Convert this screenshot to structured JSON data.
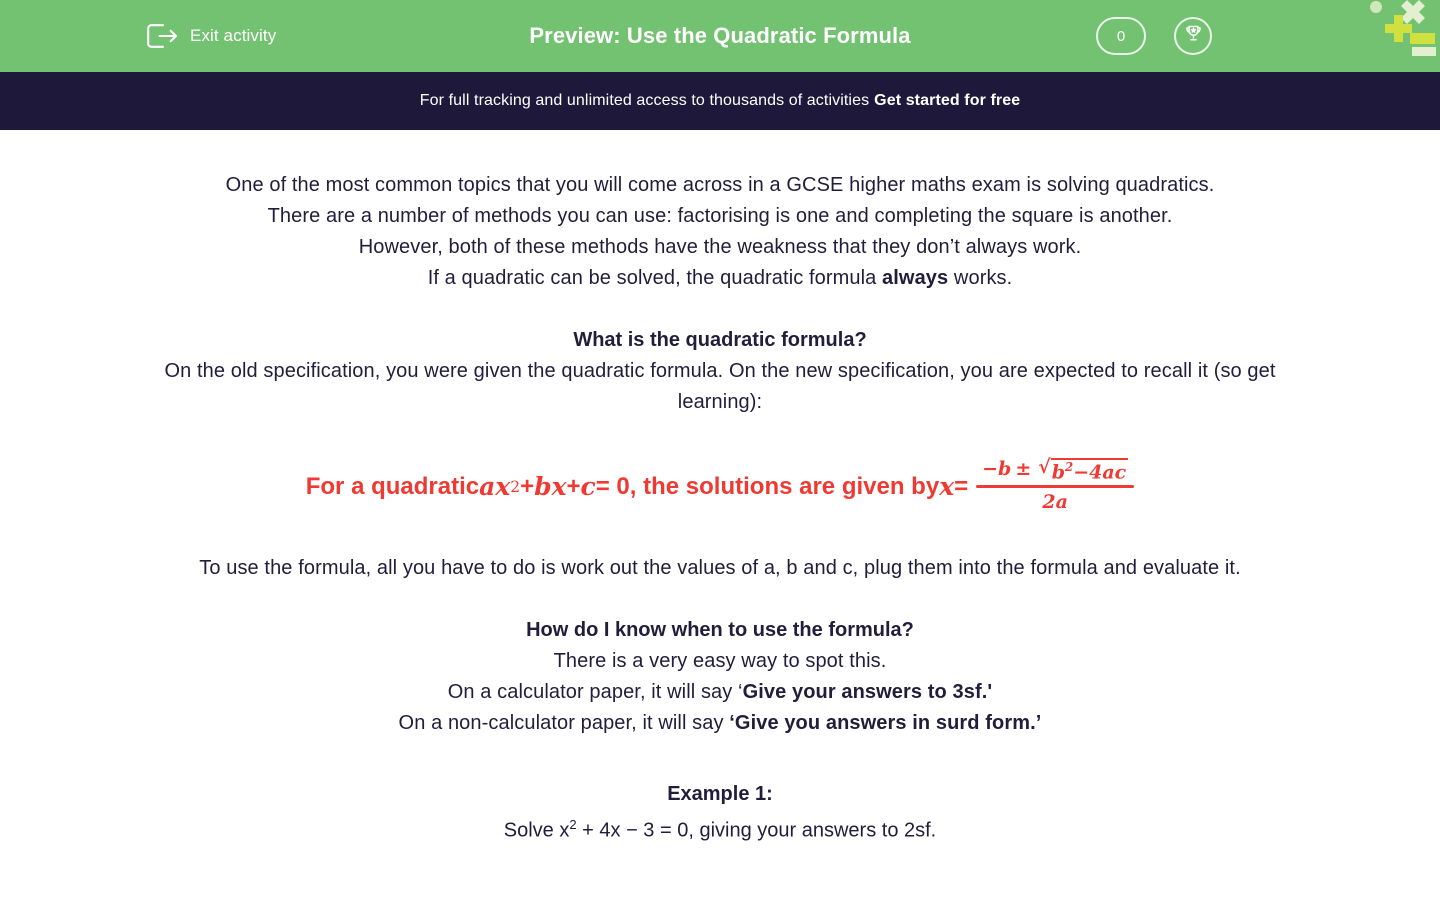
{
  "header": {
    "exit_label": "Exit activity",
    "title": "Preview: Use the Quadratic Formula",
    "score": "0",
    "exit_icon": "exit-icon",
    "trophy_icon": "trophy-icon",
    "green": "#72c271",
    "navy": "#1e193a"
  },
  "promo": {
    "text": "For full tracking and unlimited access to thousands of activities",
    "cta": "Get started for free"
  },
  "content": {
    "intro": {
      "line1": "One of the most common topics that you will come across in a GCSE higher maths exam is solving quadratics.",
      "line2": "There are a number of methods you can use: factorising is one and completing the square is another.",
      "line3": "However, both of these methods have the weakness that they don’t always work.",
      "line4_a": "If a quadratic can be solved, the quadratic formula ",
      "line4_b": "always",
      "line4_c": " works."
    },
    "section1": {
      "heading": "What is the quadratic formula?",
      "body": "On the old specification, you were given the quadratic formula. On the new specification, you are expected to recall it (so get learning):"
    },
    "formula": {
      "color": "#ef3a34",
      "lead": "For a quadratic ",
      "a": "a",
      "x": "x",
      "exp": "2",
      "plus1": " + ",
      "b": "b",
      "x2": "x",
      "plus2": " + ",
      "c": "c",
      "eq0": " = 0",
      "mid": ", the solutions are given by ",
      "xvar": "x",
      "equals": " = ",
      "numer_lead": "−b",
      "pm": "±",
      "radicand_b": "b",
      "radicand_exp": "2",
      "radicand_rest": "−4ac",
      "denom": "2a",
      "alt_text": "For a quadratic ax² + bx + c = 0, the solutions are given by x = (−b ± √(b²−4ac)) / 2a"
    },
    "after_formula": "To use the formula, all you have to do is work out the values of a, b and c,  plug them into the formula and evaluate it.",
    "section2": {
      "heading": "How do I know when to use the formula?",
      "line1": "There is a very easy way to spot this.",
      "line2_a": "On a calculator paper, it will say ‘",
      "line2_b": "Give your answers to 3sf.'",
      "line3_a": "On a non-calculator paper, it will say ",
      "line3_b": "‘Give you answers in surd form.’"
    },
    "example": {
      "heading": "Example 1:",
      "line_a": "Solve ",
      "line_b": "x",
      "line_exp": "2",
      "line_c": " + 4x − 3 = 0, giving your answers to 2sf."
    }
  }
}
